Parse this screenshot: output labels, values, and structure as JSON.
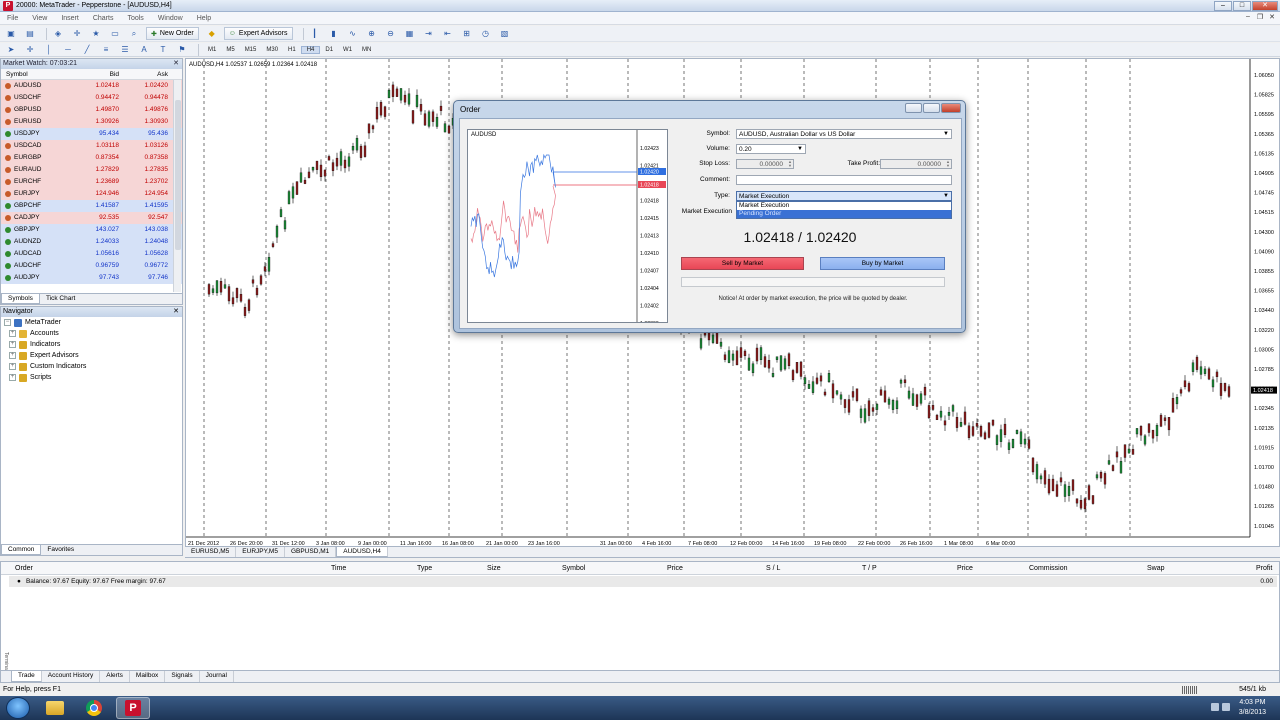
{
  "window": {
    "title": "20000: MetaTrader - Pepperstone - [AUDUSD,H4]"
  },
  "menu": [
    "File",
    "View",
    "Insert",
    "Charts",
    "Tools",
    "Window",
    "Help"
  ],
  "toolbar": {
    "new_order": "New Order",
    "expert_advisors": "Expert Advisors"
  },
  "timeframes": [
    "M1",
    "M5",
    "M15",
    "M30",
    "H1",
    "H4",
    "D1",
    "W1",
    "MN"
  ],
  "market_watch": {
    "title": "Market Watch: 07:03:21",
    "headers": [
      "Symbol",
      "Bid",
      "Ask"
    ],
    "rows": [
      {
        "symbol": "AUDUSD",
        "bid": "1.02418",
        "ask": "1.02420",
        "dir": "down"
      },
      {
        "symbol": "USDCHF",
        "bid": "0.94472",
        "ask": "0.94478",
        "dir": "down"
      },
      {
        "symbol": "GBPUSD",
        "bid": "1.49870",
        "ask": "1.49876",
        "dir": "down"
      },
      {
        "symbol": "EURUSD",
        "bid": "1.30926",
        "ask": "1.30930",
        "dir": "down"
      },
      {
        "symbol": "USDJPY",
        "bid": "95.434",
        "ask": "95.436",
        "dir": "up"
      },
      {
        "symbol": "USDCAD",
        "bid": "1.03118",
        "ask": "1.03126",
        "dir": "down"
      },
      {
        "symbol": "EURGBP",
        "bid": "0.87354",
        "ask": "0.87358",
        "dir": "down"
      },
      {
        "symbol": "EURAUD",
        "bid": "1.27829",
        "ask": "1.27835",
        "dir": "down"
      },
      {
        "symbol": "EURCHF",
        "bid": "1.23689",
        "ask": "1.23702",
        "dir": "down"
      },
      {
        "symbol": "EURJPY",
        "bid": "124.946",
        "ask": "124.954",
        "dir": "down"
      },
      {
        "symbol": "GBPCHF",
        "bid": "1.41587",
        "ask": "1.41595",
        "dir": "up"
      },
      {
        "symbol": "CADJPY",
        "bid": "92.535",
        "ask": "92.547",
        "dir": "down"
      },
      {
        "symbol": "GBPJPY",
        "bid": "143.027",
        "ask": "143.038",
        "dir": "up"
      },
      {
        "symbol": "AUDNZD",
        "bid": "1.24033",
        "ask": "1.24048",
        "dir": "up"
      },
      {
        "symbol": "AUDCAD",
        "bid": "1.05616",
        "ask": "1.05628",
        "dir": "up"
      },
      {
        "symbol": "AUDCHF",
        "bid": "0.96759",
        "ask": "0.96772",
        "dir": "up"
      },
      {
        "symbol": "AUDJPY",
        "bid": "97.743",
        "ask": "97.746",
        "dir": "up"
      }
    ],
    "tabs": [
      "Symbols",
      "Tick Chart"
    ]
  },
  "navigator": {
    "title": "Navigator",
    "root": "MetaTrader",
    "items": [
      "Accounts",
      "Indicators",
      "Expert Advisors",
      "Custom Indicators",
      "Scripts"
    ],
    "tabs": [
      "Common",
      "Favorites"
    ]
  },
  "chart": {
    "info": "AUDUSD,H4  1.02537 1.02659 1.02364 1.02418",
    "price_labels": [
      "1.06050",
      "1.05825",
      "1.05595",
      "1.05365",
      "1.05135",
      "1.04905",
      "1.04745",
      "1.04515",
      "1.04300",
      "1.04090",
      "1.03855",
      "1.03655",
      "1.03440",
      "1.03220",
      "1.03005",
      "1.02785",
      "1.02418",
      "1.02345",
      "1.02135",
      "1.01915",
      "1.01700",
      "1.01480",
      "1.01265",
      "1.01045"
    ],
    "date_labels": [
      "21 Dec 2012",
      "26 Dec 20:00",
      "31 Dec 12:00",
      "3 Jan 08:00",
      "9 Jan 00:00",
      "11 Jan 16:00",
      "16 Jan 08:00",
      "21 Jan 00:00",
      "23 Jan 16:00",
      "31 Jan 00:00",
      "4 Feb 16:00",
      "7 Feb 08:00",
      "12 Feb 00:00",
      "14 Feb 16:00",
      "19 Feb 08:00",
      "22 Feb 00:00",
      "26 Feb 16:00",
      "1 Mar 08:00",
      "6 Mar 00:00"
    ],
    "tabs": [
      "EURUSD,M5",
      "EURJPY,M5",
      "GBPUSD,M1",
      "AUDUSD,H4"
    ],
    "current_price": "1.02418"
  },
  "order_dialog": {
    "title": "Order",
    "mini_chart_symbol": "AUDUSD",
    "mini_prices": [
      "1.02423",
      "1.02421",
      "1.02420",
      "1.02418",
      "1.02415",
      "1.02413",
      "1.02410",
      "1.02407",
      "1.02404",
      "1.02402",
      "1.02399"
    ],
    "symbol_label": "Symbol:",
    "symbol_value": "AUDUSD, Australian Dollar vs US Dollar",
    "volume_label": "Volume:",
    "volume_value": "0.20",
    "stoploss_label": "Stop Loss:",
    "stoploss_value": "0.00000",
    "takeprofit_label": "Take Profit:",
    "takeprofit_value": "0.00000",
    "comment_label": "Comment:",
    "type_label": "Type:",
    "type_value": "Market Execution",
    "type_options": [
      "Market Execution",
      "Pending Order"
    ],
    "execution_label": "Market Execution",
    "quote": "1.02418 / 1.02420",
    "sell_label": "Sell by Market",
    "buy_label": "Buy by Market",
    "notice": "Notice! At order by market execution, the price will be quoted by dealer."
  },
  "terminal": {
    "headers": [
      "Order",
      "Time",
      "Type",
      "Size",
      "Symbol",
      "Price",
      "S / L",
      "T / P",
      "Price",
      "Commission",
      "Swap",
      "Profit"
    ],
    "balance_text": "Balance: 97.67  Equity: 97.67  Free margin: 97.67",
    "balance_profit": "0.00",
    "side_label": "Terminal",
    "tabs": [
      "Trade",
      "Account History",
      "Alerts",
      "Mailbox",
      "Signals",
      "Journal"
    ]
  },
  "statusbar": {
    "help": "For Help, press F1",
    "kb": "545/1 kb"
  },
  "taskbar": {
    "time": "4:03 PM",
    "date": "3/8/2013"
  },
  "colors": {
    "down_row": "#f6d6d6",
    "up_row": "#d5e1f7",
    "sell": "#e84656",
    "buy": "#8bb0ee",
    "bid_line": "#e84656",
    "ask_line": "#2f6fe0"
  }
}
